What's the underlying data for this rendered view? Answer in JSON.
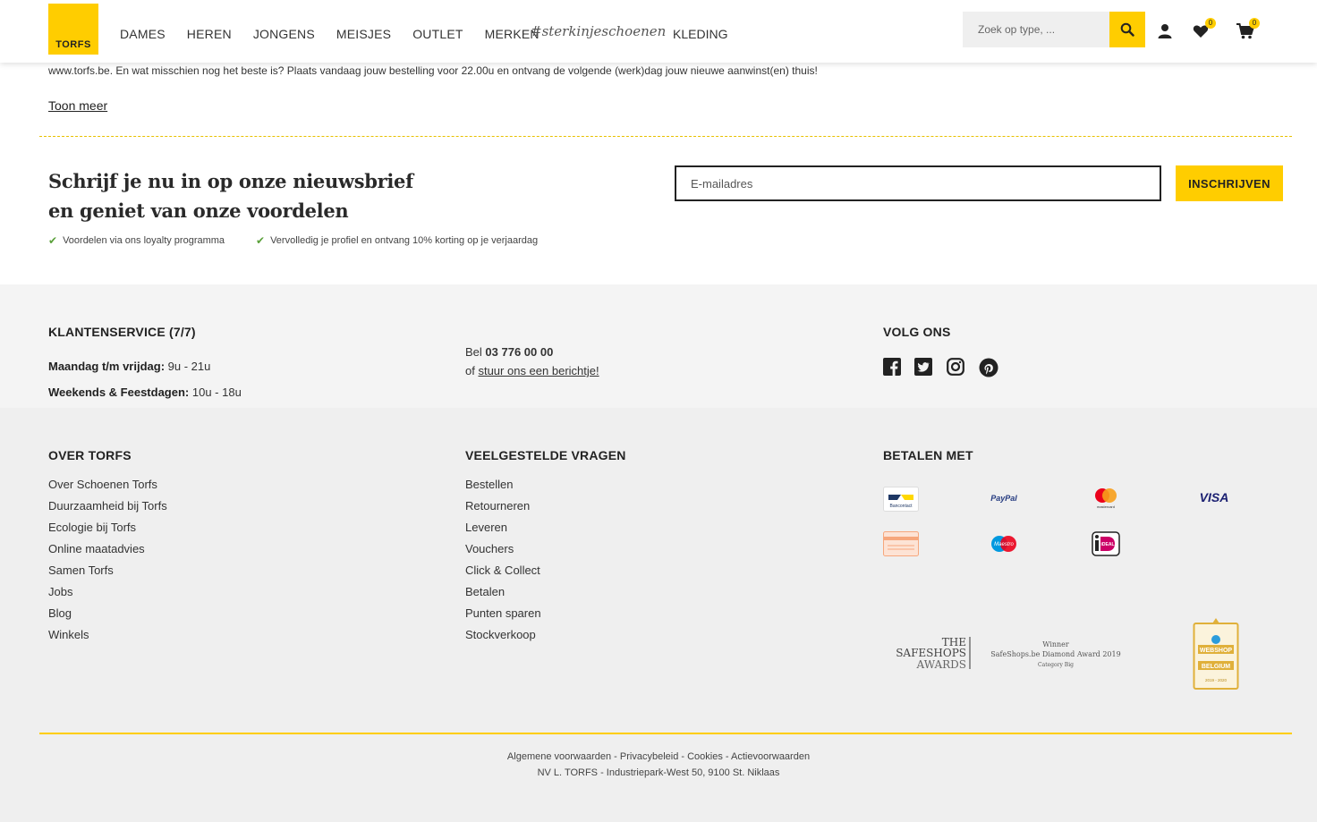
{
  "header": {
    "logo_text": "TORFS",
    "nav": [
      "DAMES",
      "HEREN",
      "JONGENS",
      "MEISJES",
      "OUTLET",
      "MERKEN"
    ],
    "hashtag": "#sterkinjeschoenen",
    "kleding": "KLEDING",
    "search_placeholder": "Zoek op type, ...",
    "wishlist_count": "0",
    "cart_count": "0"
  },
  "intro": {
    "text": "www.torfs.be. En wat misschien nog het beste is? Plaats vandaag jouw bestelling voor 22.00u en ontvang de volgende (werk)dag jouw nieuwe aanwinst(en) thuis!",
    "toon_meer": "Toon meer"
  },
  "newsletter": {
    "title_line1": "Schrijf je nu in op onze nieuwsbrief",
    "title_line2": "en geniet van onze voordelen",
    "check1": "Voordelen via ons loyalty programma",
    "check2": "Vervolledig je profiel en ontvang 10% korting op je verjaardag",
    "email_placeholder": "E-mailadres",
    "button": "INSCHRIJVEN"
  },
  "service": {
    "heading": "KLANTENSERVICE (7/7)",
    "weekdays_label": "Maandag t/m vrijdag:",
    "weekdays_hours": " 9u - 21u",
    "weekend_label": "Weekends & Feestdagen:",
    "weekend_hours": " 10u - 18u",
    "bel_prefix": "Bel ",
    "phone": "03 776 00 00",
    "of_prefix": "of ",
    "message_link": "stuur ons een berichtje!",
    "follow_heading": "VOLG ONS"
  },
  "footer": {
    "over_heading": "OVER TORFS",
    "over_links": [
      "Over Schoenen Torfs",
      "Duurzaamheid bij Torfs",
      "Ecologie bij Torfs",
      "Online maatadvies",
      "Samen Torfs",
      "Jobs",
      "Blog",
      "Winkels"
    ],
    "faq_heading": "VEELGESTELDE VRAGEN",
    "faq_links": [
      "Bestellen",
      "Retourneren",
      "Leveren",
      "Vouchers",
      "Click & Collect",
      "Betalen",
      "Punten sparen",
      "Stockverkoop"
    ],
    "pay_heading": "BETALEN MET",
    "pay_labels": {
      "bancontact": "Bancontact",
      "paypal": "PayPal",
      "mastercard": "mastercard",
      "visa": "VISA",
      "maestro": "Maestro",
      "ideal": "iDEAL"
    },
    "safeshops": {
      "the": "THE",
      "name": "SAFESHOPS",
      "awards": "AWARDS",
      "winner": "Winner",
      "award": "SafeShops.be Diamond Award 2019",
      "category": "Category Big"
    },
    "webshop_badge": {
      "line1": "WEBSHOP",
      "line2": "BELGIUM",
      "years": "2019 - 2020"
    },
    "legal_links": [
      "Algemene voorwaarden",
      "Privacybeleid",
      "Cookies",
      "Actievoorwaarden"
    ],
    "separator": " - ",
    "address": "NV L. TORFS - Industriepark-West 50, 9100 St. Niklaas"
  },
  "colors": {
    "brand_yellow": "#ffcd00",
    "check_green": "#5aa03a",
    "footer_bg": "#efefef"
  }
}
